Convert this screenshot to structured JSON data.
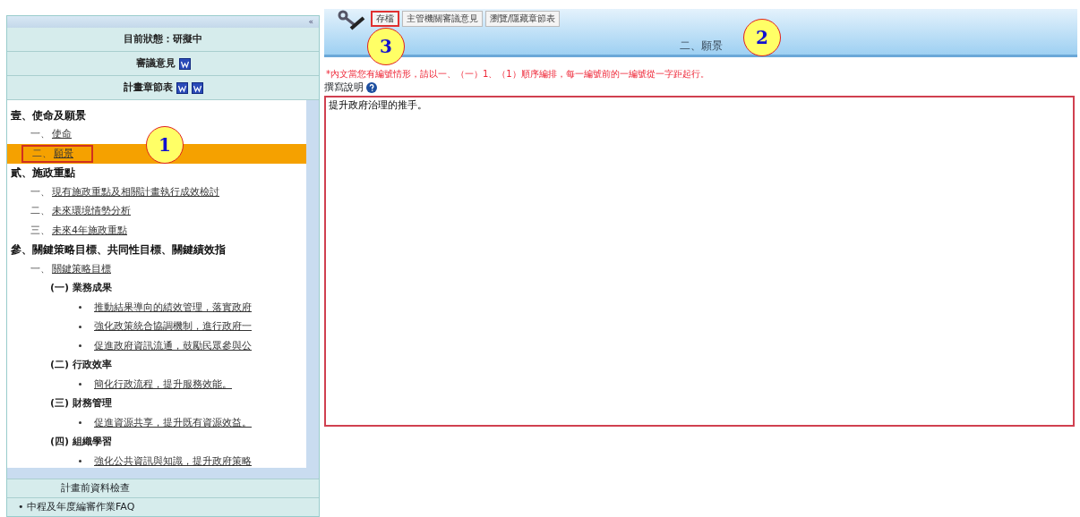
{
  "sidebar": {
    "collapse": "«",
    "header_rows": [
      {
        "label": "目前狀態：研擬中",
        "icons": []
      },
      {
        "label": "審議意見",
        "icons": [
          {
            "kind": "doc"
          }
        ]
      },
      {
        "label": "計畫章節表",
        "icons": [
          {
            "kind": "doc"
          },
          {
            "kind": "doc"
          }
        ]
      }
    ],
    "tree": [
      {
        "label": "壹、使命及願景",
        "kind": "section",
        "selected": false,
        "children": [
          {
            "prefix": "一、",
            "label": "使命",
            "kind": "link",
            "selected": false
          },
          {
            "prefix": "二、",
            "label": "願景",
            "kind": "link",
            "selected": true
          }
        ]
      },
      {
        "label": "貳、施政重點",
        "kind": "section",
        "selected": false,
        "children": [
          {
            "prefix": "一、",
            "label": "現有施政重點及相關計畫執行成效檢討",
            "kind": "link",
            "selected": false
          },
          {
            "prefix": "二、",
            "label": "未來環境情勢分析",
            "kind": "link",
            "selected": false
          },
          {
            "prefix": "三、",
            "label": "未來4年施政重點",
            "kind": "link",
            "selected": false
          }
        ]
      },
      {
        "label": "參、關鍵策略目標、共同性目標、關鍵績效指",
        "kind": "section",
        "selected": false,
        "children": [
          {
            "prefix": "一、",
            "label": "關鍵策略目標",
            "kind": "link",
            "selected": false,
            "children": [
              {
                "label": "(一) 業務成果",
                "kind": "group",
                "selected": false,
                "children": [
                  {
                    "label": "推動結果導向的績效管理，落實政府",
                    "kind": "bullet",
                    "selected": false
                  },
                  {
                    "label": "強化政策統合協調機制，進行政府一",
                    "kind": "bullet",
                    "selected": false
                  },
                  {
                    "label": "促進政府資訊流通，鼓勵民眾參與公",
                    "kind": "bullet",
                    "selected": false
                  }
                ]
              },
              {
                "label": "(二) 行政效率",
                "kind": "group",
                "selected": false,
                "children": [
                  {
                    "label": "簡化行政流程，提升服務效能。",
                    "kind": "bullet",
                    "selected": false
                  }
                ]
              },
              {
                "label": "(三) 財務管理",
                "kind": "group",
                "selected": false,
                "children": [
                  {
                    "label": "促進資源共享，提升既有資源效益。",
                    "kind": "bullet",
                    "selected": false
                  }
                ]
              },
              {
                "label": "(四) 組織學習",
                "kind": "group",
                "selected": false,
                "children": [
                  {
                    "label": "強化公共資訊與知識，提升政府策略",
                    "kind": "bullet",
                    "selected": false
                  }
                ]
              }
            ]
          }
        ]
      }
    ],
    "footer_rows": [
      {
        "label": "計畫前資料檢查",
        "kind": "link"
      },
      {
        "label": "• 中程及年度編審作業FAQ",
        "kind": "link"
      }
    ]
  },
  "toolbar": {
    "tabs": [
      {
        "label": "存檔",
        "selected": true
      },
      {
        "label": "主管機關審議意見",
        "selected": false
      },
      {
        "label": "瀏覽/隱藏章節表",
        "selected": false
      }
    ]
  },
  "editor": {
    "title": "二、願景",
    "note": "*內文當您有編號情形，請以一、（一）1、（1）順序編排，每一編號前的一編號從一字距起行。",
    "help_label": "撰寫說明",
    "value": "提升政府治理的推手。"
  },
  "callouts": [
    "1",
    "2",
    "3"
  ]
}
